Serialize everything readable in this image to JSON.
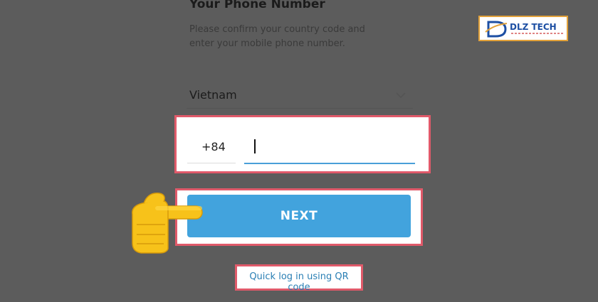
{
  "header": {
    "title": "Your Phone Number",
    "description": "Please confirm your country code and enter your mobile phone number."
  },
  "country": {
    "selected": "Vietnam"
  },
  "phone": {
    "country_code": "+84",
    "number_value": ""
  },
  "actions": {
    "next_label": "NEXT",
    "qr_link_label": "Quick log in using QR code"
  },
  "watermark": {
    "brand": "DLZ TECH"
  },
  "colors": {
    "accent": "#42a3dd",
    "highlight": "#e05a6a",
    "link": "#2a7fb4"
  }
}
